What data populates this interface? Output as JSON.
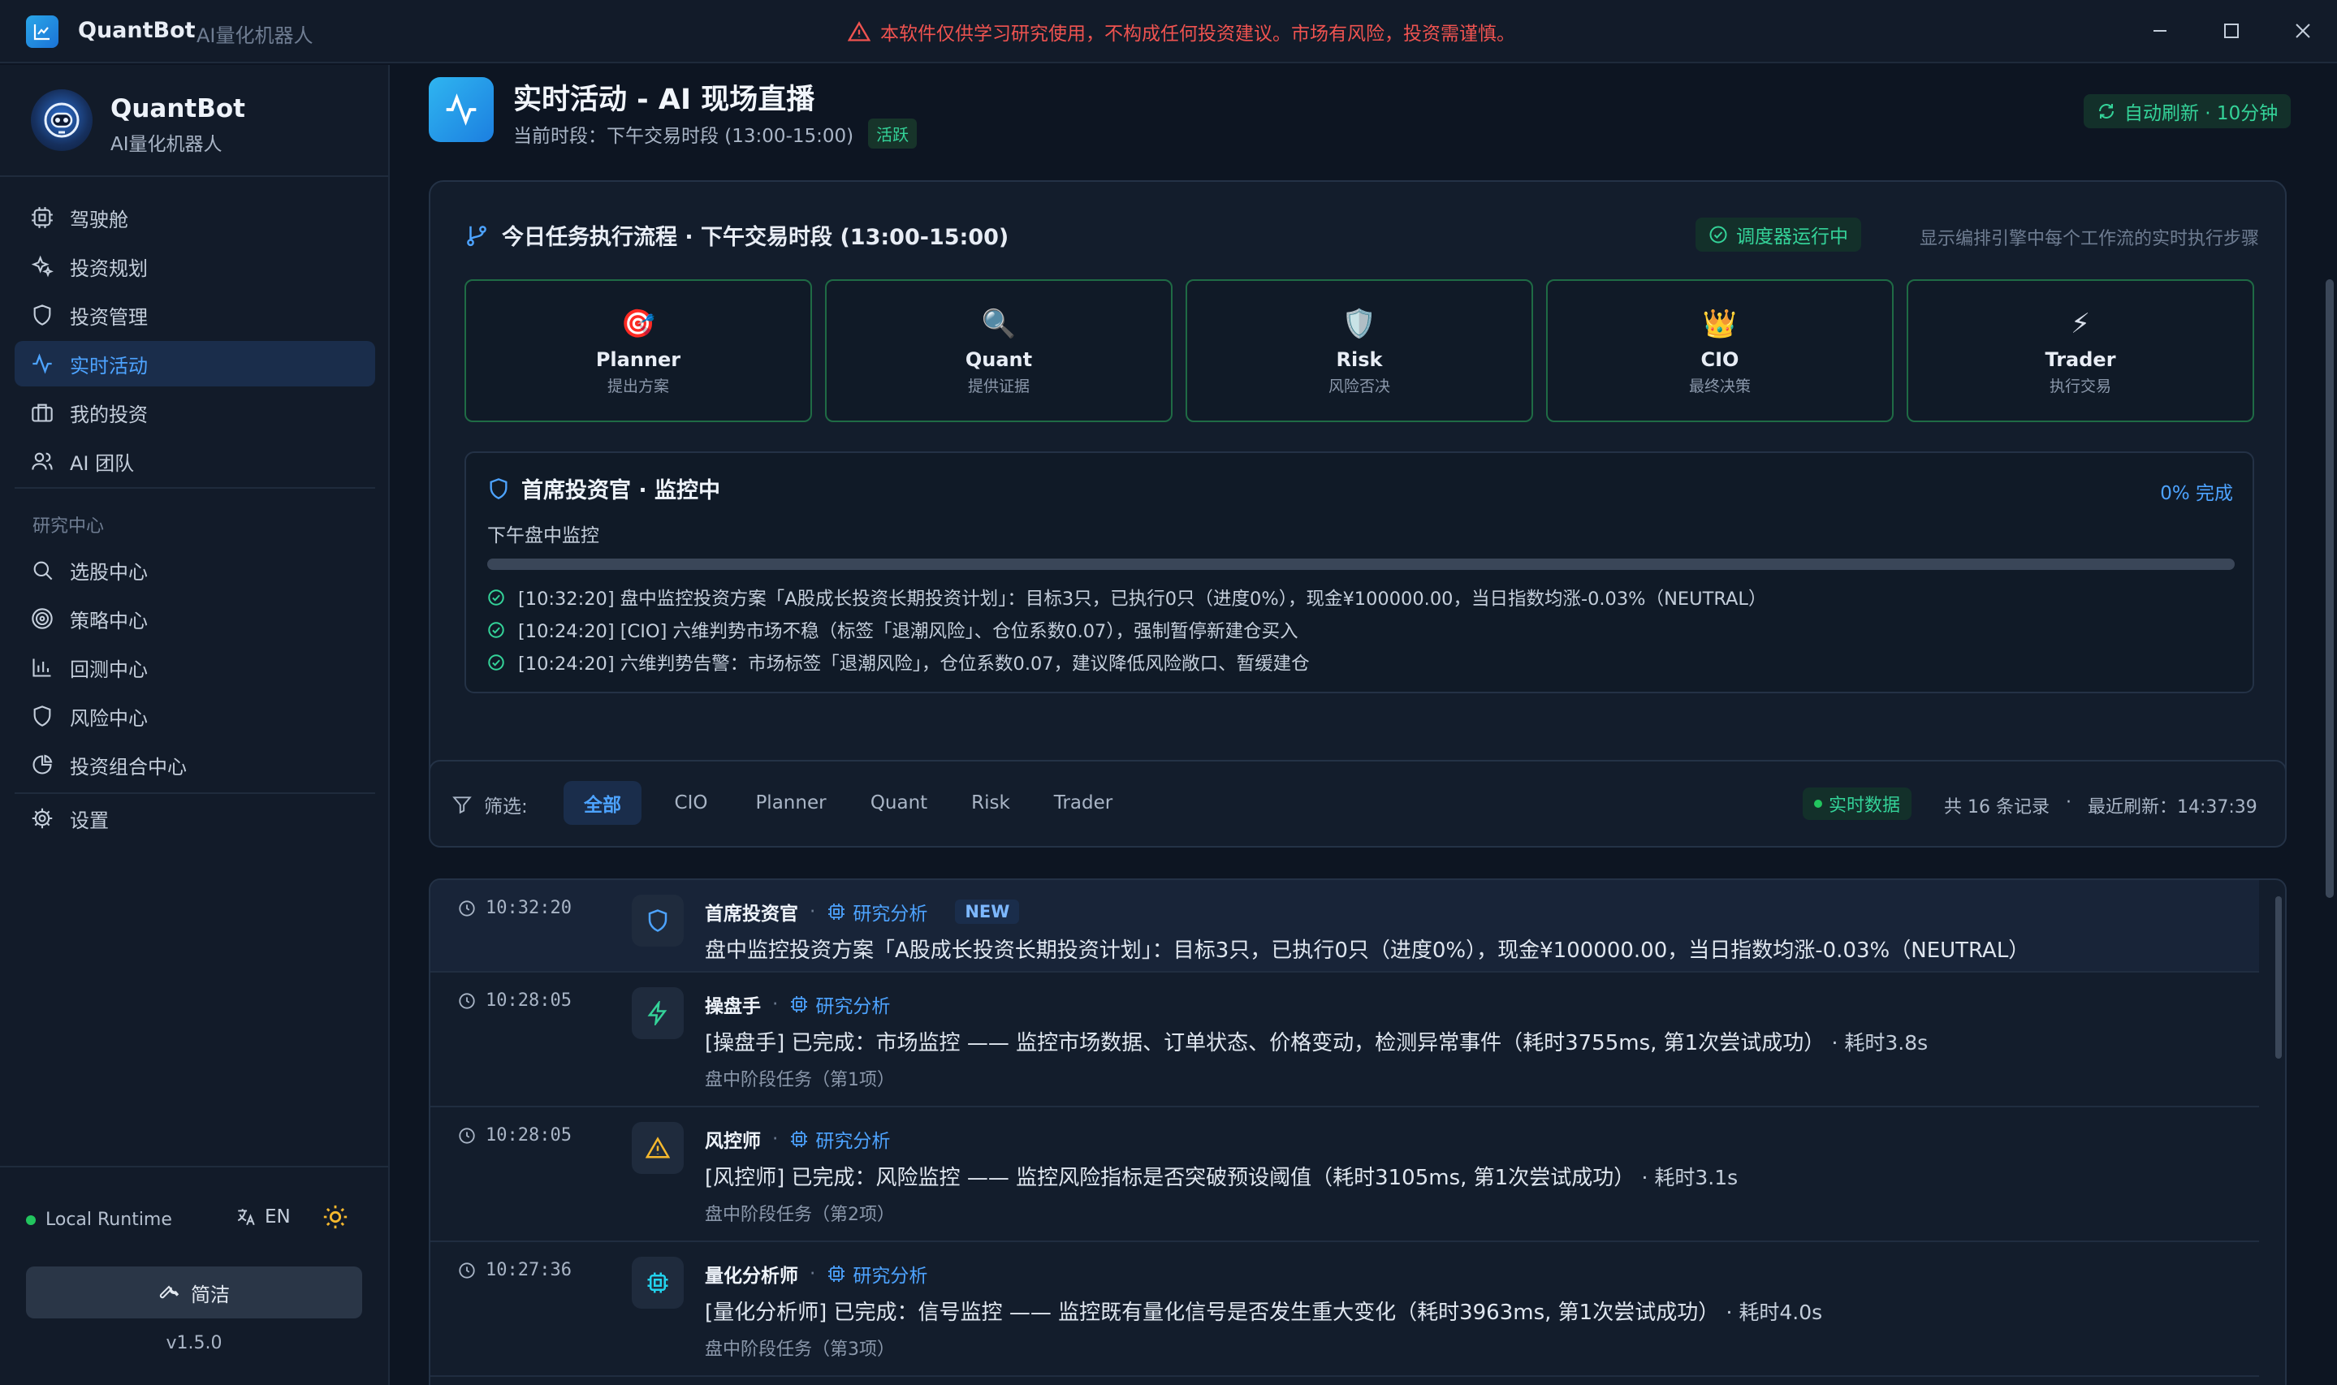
{
  "titlebar": {
    "app_name": "QuantBot",
    "app_sub": "AI量化机器人",
    "disclaimer": "本软件仅供学习研究使用，不构成任何投资建议。市场有风险，投资需谨慎。"
  },
  "sidebar": {
    "brand_name": "QuantBot",
    "brand_sub": "AI量化机器人",
    "items": [
      {
        "label": "驾驶舱",
        "icon": "cockpit-icon"
      },
      {
        "label": "投资规划",
        "icon": "sparkles-icon"
      },
      {
        "label": "投资管理",
        "icon": "shield-icon"
      },
      {
        "label": "实时活动",
        "icon": "activity-icon",
        "active": true
      },
      {
        "label": "我的投资",
        "icon": "briefcase-icon"
      },
      {
        "label": "AI 团队",
        "icon": "users-icon"
      }
    ],
    "section_label": "研究中心",
    "research_items": [
      {
        "label": "选股中心",
        "icon": "search-icon"
      },
      {
        "label": "策略中心",
        "icon": "target-icon"
      },
      {
        "label": "回测中心",
        "icon": "bar-chart-icon"
      },
      {
        "label": "风险中心",
        "icon": "shield-icon"
      },
      {
        "label": "投资组合中心",
        "icon": "pie-chart-icon"
      }
    ],
    "settings_label": "设置",
    "runtime": "Local Runtime",
    "lang": "EN",
    "mode_label": "简洁",
    "version": "v1.5.0"
  },
  "header": {
    "title": "实时活动 - AI 现场直播",
    "session": "当前时段：下午交易时段 (13:00-15:00)",
    "status_badge": "活跃",
    "auto_refresh": "自动刷新 · 10分钟"
  },
  "workflow": {
    "title": "今日任务执行流程 · 下午交易时段 (13:00-15:00)",
    "scheduler": "调度器运行中",
    "note": "显示编排引擎中每个工作流的实时执行步骤",
    "agents": [
      {
        "name": "Planner",
        "role": "提出方案",
        "emoji": "🎯"
      },
      {
        "name": "Quant",
        "role": "提供证据",
        "emoji": "🔍"
      },
      {
        "name": "Risk",
        "role": "风险否决",
        "emoji": "🛡️"
      },
      {
        "name": "CIO",
        "role": "最终决策",
        "emoji": "👑"
      },
      {
        "name": "Trader",
        "role": "执行交易",
        "emoji": "⚡"
      }
    ],
    "monitor": {
      "title": "首席投资官 · 监控中",
      "percent_label": "0% 完成",
      "progress": 0,
      "subtitle": "下午盘中监控",
      "logs": [
        "[10:32:20] 盘中监控投资方案「A股成长投资长期投资计划」：目标3只，已执行0只（进度0%），现金¥100000.00，当日指数均涨-0.03%（NEUTRAL）",
        "[10:24:20] [CIO] 六维判势市场不稳（标签「退潮风险」、仓位系数0.07），强制暂停新建仓买入",
        "[10:24:20] 六维判势告警：市场标签「退潮风险」，仓位系数0.07，建议降低风险敞口、暂缓建仓"
      ]
    }
  },
  "filter": {
    "label": "筛选:",
    "chips": [
      "全部",
      "CIO",
      "Planner",
      "Quant",
      "Risk",
      "Trader"
    ],
    "active_chip": "全部",
    "live": "实时数据",
    "count": "共 16 条记录",
    "dot": "·",
    "last_refresh": "最近刷新：14:37:39"
  },
  "feed": [
    {
      "time": "10:32:20",
      "who": "首席投资官",
      "tag": "研究分析",
      "new": "NEW",
      "icon": "shield-icon",
      "message": "盘中监控投资方案「A股成长投资长期投资计划」：目标3只，已执行0只（进度0%），现金¥100000.00，当日指数均涨-0.03%（NEUTRAL）",
      "duration": "",
      "stage": ""
    },
    {
      "time": "10:28:05",
      "who": "操盘手",
      "tag": "研究分析",
      "icon": "lightning-icon",
      "message": "[操盘手] 已完成：市场监控 —— 监控市场数据、订单状态、价格变动，检测异常事件（耗时3755ms, 第1次尝试成功）",
      "duration": "· 耗时3.8s",
      "stage": "盘中阶段任务（第1项）"
    },
    {
      "time": "10:28:05",
      "who": "风控师",
      "tag": "研究分析",
      "icon": "warning-icon",
      "message": "[风控师] 已完成：风险监控 —— 监控风险指标是否突破预设阈值（耗时3105ms, 第1次尝试成功）",
      "duration": "· 耗时3.1s",
      "stage": "盘中阶段任务（第2项）"
    },
    {
      "time": "10:27:36",
      "who": "量化分析师",
      "tag": "研究分析",
      "icon": "cpu-icon",
      "message": "[量化分析师] 已完成：信号监控 —— 监控既有量化信号是否发生重大变化（耗时3963ms, 第1次尝试成功）",
      "duration": "· 耗时4.0s",
      "stage": "盘中阶段任务（第3项）"
    }
  ],
  "colors": {
    "accent": "#4da3ff",
    "success": "#34d399",
    "danger": "#ef5350",
    "warning": "#f5b82e"
  }
}
